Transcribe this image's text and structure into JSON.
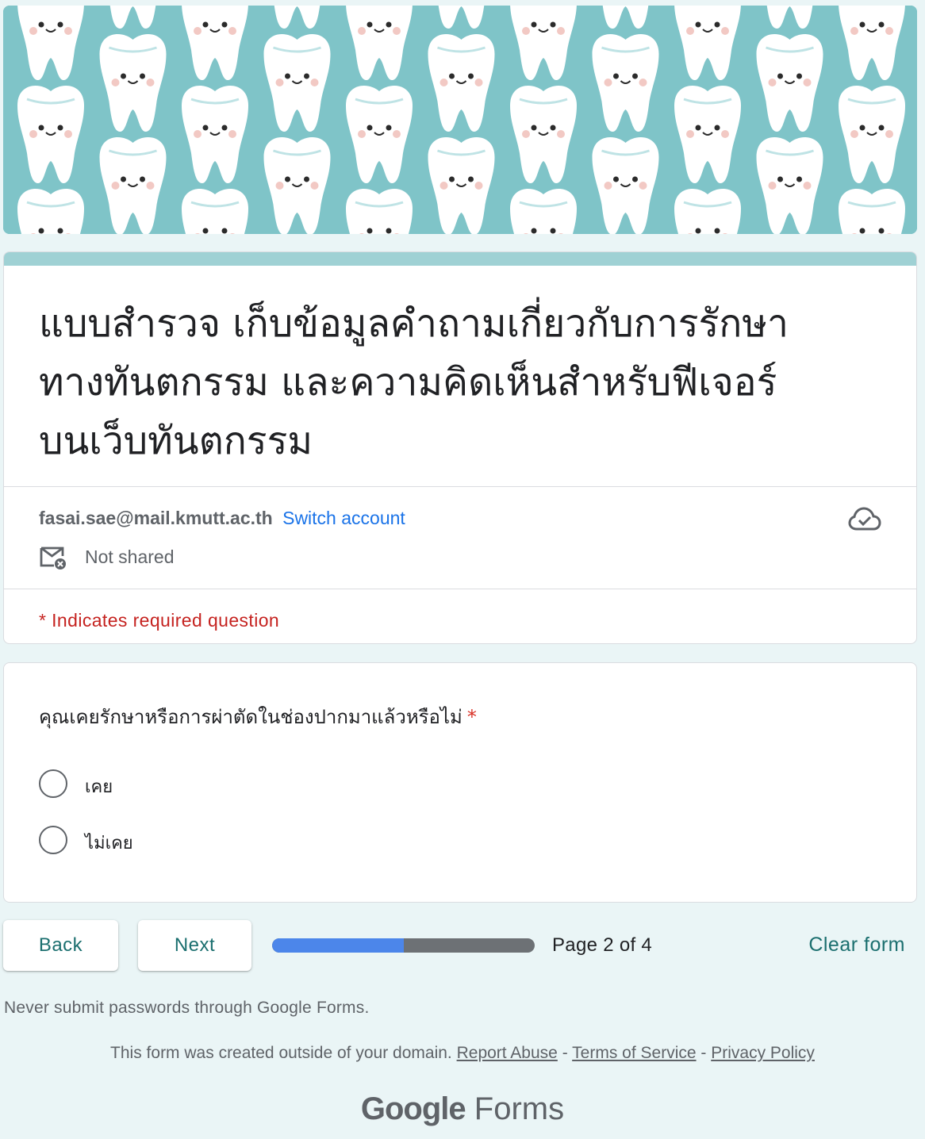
{
  "form": {
    "title_line1": "แบบสำรวจ เก็บข้อมูลคำถามเกี่ยวกับการรักษา",
    "title_line2": "ทางทันตกรรม  และความคิดเห็นสำหรับฟีเจอร์",
    "title_line3": "บนเว็บทันตกรรม",
    "account_email": "fasai.sae@mail.kmutt.ac.th",
    "switch_account": "Switch account",
    "not_shared": "Not shared",
    "required_note": "* Indicates required question"
  },
  "question": {
    "text": "คุณเคยรักษาหรือการผ่าตัดในช่องปากมาแล้วหรือไม่",
    "required_mark": "*",
    "options": [
      "เคย",
      "ไม่เคย"
    ]
  },
  "nav": {
    "back": "Back",
    "next": "Next",
    "progress_fraction": 0.5,
    "page_indicator": "Page 2 of 4",
    "clear_form": "Clear form"
  },
  "footer": {
    "never_submit": "Never submit passwords through Google Forms.",
    "created_outside": "This form was created outside of your domain.",
    "report_abuse": "Report Abuse",
    "sep": "-",
    "terms": "Terms of Service",
    "privacy": "Privacy Policy",
    "logo_google": "Google",
    "logo_forms": "Forms"
  },
  "colors": {
    "banner_bg": "#7fc4c8",
    "accent": "#1b6f6f",
    "progress_fill": "#4c86ea",
    "required": "#d93025"
  },
  "icons": {
    "banner": "tooth-pattern-icon",
    "cloud": "cloud-check-icon",
    "not_shared": "mail-not-shared-icon"
  }
}
